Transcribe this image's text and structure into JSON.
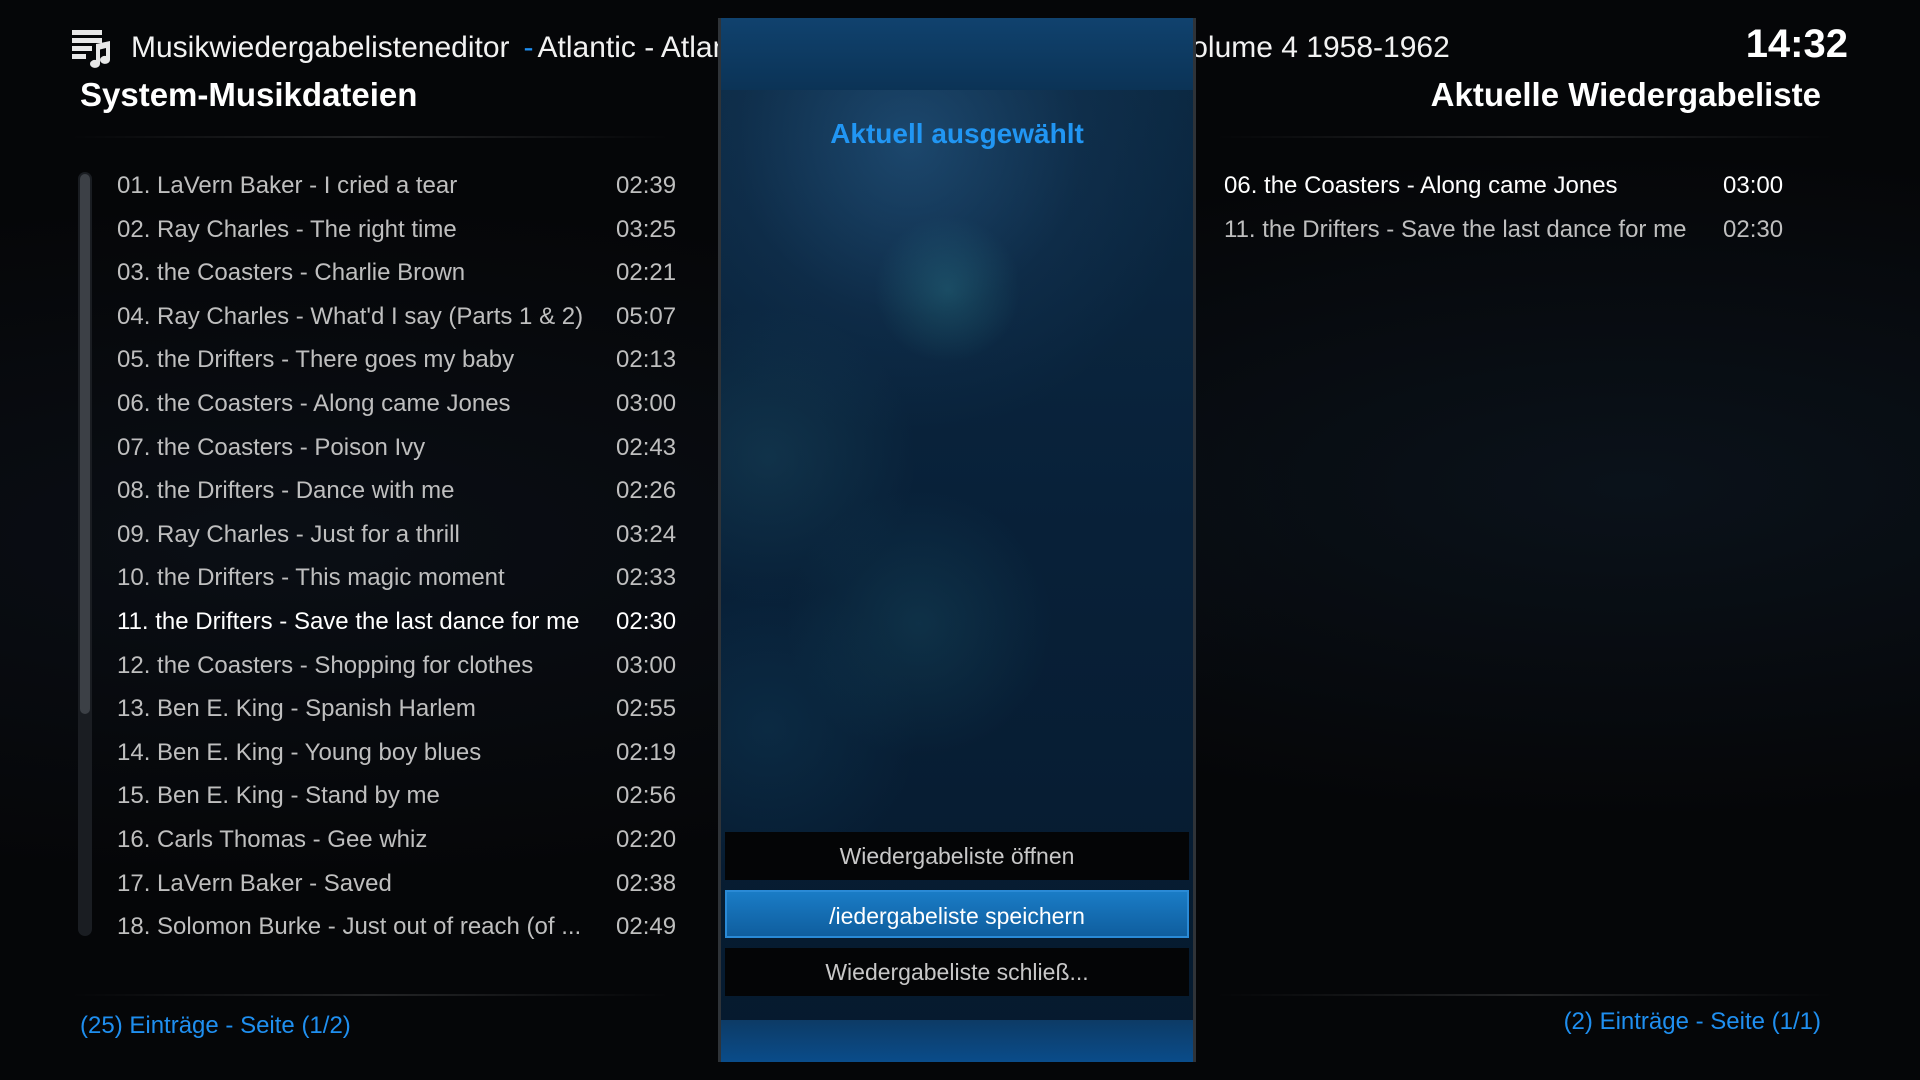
{
  "header": {
    "app_title": "Musikwiedergabelisteneditor",
    "separator": "-",
    "album": "Atlantic - Atlantic Rhythm and Blues 1947-1974 Volume 4 1958-1962",
    "clock": "14:32"
  },
  "left_panel": {
    "heading": "System-Musikdateien",
    "footer": "(25) Einträge - Seite (1/2)",
    "tracks": [
      {
        "title": "01. LaVern Baker - I cried a tear",
        "duration": "02:39"
      },
      {
        "title": "02. Ray Charles - The right time",
        "duration": "03:25"
      },
      {
        "title": "03. the Coasters - Charlie Brown",
        "duration": "02:21"
      },
      {
        "title": "04. Ray Charles - What'd I say (Parts 1 & 2)",
        "duration": "05:07"
      },
      {
        "title": "05. the Drifters - There goes my baby",
        "duration": "02:13"
      },
      {
        "title": "06. the Coasters - Along came Jones",
        "duration": "03:00"
      },
      {
        "title": "07. the Coasters - Poison Ivy",
        "duration": "02:43"
      },
      {
        "title": "08. the Drifters - Dance with me",
        "duration": "02:26"
      },
      {
        "title": "09. Ray Charles - Just for a thrill",
        "duration": "03:24"
      },
      {
        "title": "10. the Drifters - This magic moment",
        "duration": "02:33"
      },
      {
        "title": "11. the Drifters - Save the last dance for me",
        "duration": "02:30"
      },
      {
        "title": "12. the Coasters - Shopping for clothes",
        "duration": "03:00"
      },
      {
        "title": "13. Ben E. King - Spanish Harlem",
        "duration": "02:55"
      },
      {
        "title": "14. Ben E. King - Young boy blues",
        "duration": "02:19"
      },
      {
        "title": "15. Ben E. King - Stand by me",
        "duration": "02:56"
      },
      {
        "title": "16. Carls Thomas - Gee whiz",
        "duration": "02:20"
      },
      {
        "title": "17. LaVern Baker - Saved",
        "duration": "02:38"
      },
      {
        "title": "18. Solomon Burke - Just out of reach (of ...",
        "duration": "02:49"
      }
    ]
  },
  "center_panel": {
    "heading": "Aktuell ausgewählt",
    "buttons": {
      "open": "Wiedergabeliste öffnen",
      "save": "/iedergabeliste speichern",
      "close": "Wiedergabeliste schließ..."
    }
  },
  "right_panel": {
    "heading": "Aktuelle Wiedergabeliste",
    "footer": "(2) Einträge - Seite (1/1)",
    "tracks": [
      {
        "title": "06. the Coasters - Along came Jones",
        "duration": "03:00"
      },
      {
        "title": "11. the Drifters - Save the last dance for me",
        "duration": "02:30"
      }
    ]
  },
  "colors": {
    "accent": "#1f8ff0",
    "focused_button": "#1a7cc6",
    "background": "#050608"
  },
  "icons": {
    "logo": "playlist-music-icon"
  }
}
